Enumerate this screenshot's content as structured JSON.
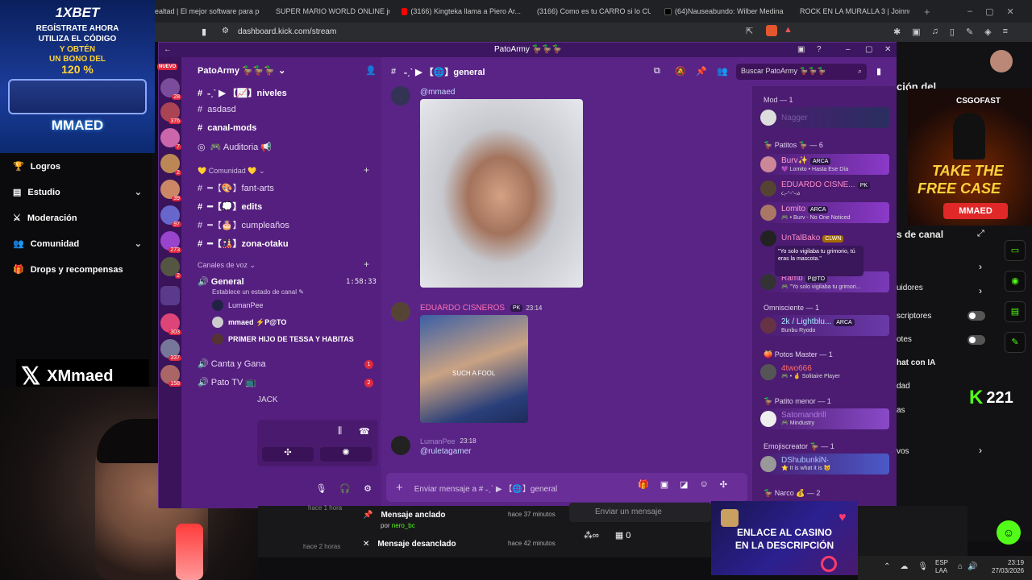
{
  "browser": {
    "tabs": [
      "ealtad | El mejor software para pote",
      "SUPER MARIO WORLD ONLINE jueg",
      "(3166) Kingteka llama a Piero Ar...",
      "(3166) Como es tu CARRO si lo CUID",
      "(64)Nauseabundo: Wilber Medina",
      "ROCK EN LA MURALLA 3 | Joinnus"
    ],
    "url": "dashboard.kick.com/stream"
  },
  "ad_1xbet": {
    "brand": "1XBET",
    "line1": "REGÍSTRATE AHORA",
    "line2": "UTILIZA EL CÓDIGO",
    "line3": "Y OBTÉN",
    "line4": "UN BONO DEL",
    "line5": "120 %",
    "code": "MMAED"
  },
  "x_handle": "XMmaed",
  "kick_nav": [
    {
      "label": "Logros",
      "icon": "trophy-icon",
      "chevron": false
    },
    {
      "label": "Estudio",
      "icon": "film-icon",
      "chevron": true
    },
    {
      "label": "Moderación",
      "icon": "sword-icon",
      "chevron": false
    },
    {
      "label": "Comunidad",
      "icon": "people-icon",
      "chevron": true
    },
    {
      "label": "Drops y recompensas",
      "icon": "gift-icon",
      "chevron": false
    }
  ],
  "discord": {
    "window_title": "PatoArmy 🦆🦆🦆",
    "server_name": "PatoArmy 🦆🦆🦆",
    "nuevo_badge": "NUEVO",
    "server_badges": [
      "28",
      "376",
      "7",
      "2",
      "39",
      "97",
      "273",
      "2",
      "303",
      "337",
      "158"
    ],
    "channels_top": [
      {
        "label": "˗ˏˋ ▶ 【📈】niveles",
        "bold": true
      },
      {
        "label": "asdasd",
        "bold": false
      },
      {
        "label": "canal-mods",
        "bold": true
      },
      {
        "label": "🎮 Auditoria 📢",
        "bold": false
      }
    ],
    "category_comunidad": "💛 Comunidad 💛",
    "channels_comunidad": [
      {
        "label": "━【🎨】fant-arts",
        "bold": false
      },
      {
        "label": "━【💭】edits",
        "bold": true
      },
      {
        "label": "━【🎂】cumpleaños",
        "bold": false
      },
      {
        "label": "━【🎎】zona-otaku",
        "bold": true
      }
    ],
    "category_voz": "Canales de voz",
    "voice_general": "General",
    "voice_timer": "1:58:33",
    "voice_status": "Establece un estado de canal",
    "voice_users": [
      "LumanPee",
      "mmaed ⚡P@TO",
      "PRIMER HIJO DE TESSA Y HABITAS"
    ],
    "voice_channels": [
      {
        "label": "Canta y Gana",
        "badge": "1"
      },
      {
        "label": "Pato TV 📺",
        "badge": "2"
      }
    ],
    "voice_cut": "JACK",
    "chat_channel": "˗ˏˋ ▶ 【🌐】general",
    "search_placeholder": "Buscar PatoArmy 🦆🦆🦆",
    "messages": [
      {
        "mention": "@mmaed"
      },
      {
        "author": "EDUARDO CISNEROS",
        "tag": "PK",
        "time": "23:14",
        "image_caption": "SUCH A FOOL"
      },
      {
        "author": "LumanPee",
        "time": "23:18",
        "text": "@ruletagamer"
      }
    ],
    "input_placeholder": "Enviar mensaje a # ˗ˏˋ ▶ 【🌐】general",
    "member_groups": [
      {
        "title": "Mod — 1",
        "members": [
          {
            "name": "Nagger",
            "status": "",
            "tag": ""
          }
        ]
      },
      {
        "title": "🦆 Patitos 🦆 — 6",
        "members": [
          {
            "name": "Burv✨",
            "status": "💜 Lomito • Hasta Ese Día",
            "tag": "ARCA"
          },
          {
            "name": "EDUARDO CISNE...",
            "status": "૮₍˶ᵔᵕᵔ˶₎ა",
            "tag": "PK"
          },
          {
            "name": "Lomito",
            "status": "🎮 • Burv - No One Noticed",
            "tag": "ARCA"
          },
          {
            "name": "UnTalBako",
            "status": "",
            "tag": "CLWN"
          },
          {
            "name": "Ramb",
            "status": "🎮 \"Yo solo vigilaba tu grimori...",
            "tag": "P@TO"
          }
        ]
      },
      {
        "title": "Omnisciente — 1",
        "members": [
          {
            "name": "2k / Lightblu...",
            "status": "Bunbu Ryodo",
            "tag": "ARCA"
          }
        ]
      },
      {
        "title": "🍑 Potos Master — 1",
        "members": [
          {
            "name": "4two666",
            "status": "🎮 • 🤞 Solitaire Player",
            "tag": ""
          }
        ]
      },
      {
        "title": "🦆 Patito menor — 1",
        "members": [
          {
            "name": "Satomandrill",
            "status": "🎮 Mindustry",
            "tag": ""
          }
        ]
      },
      {
        "title": "Emojiscreator 🦆 — 1",
        "members": [
          {
            "name": "DShubunkiN·",
            "status": "⭐ It is what it is 😺",
            "tag": ""
          }
        ]
      },
      {
        "title": "🦆 Narco 💰 — 2",
        "members": []
      }
    ],
    "tooltip": "\"Yo solo vigilaba tu grimorio, tú eras la mascota.\""
  },
  "kick_right": {
    "items": [
      "ción del",
      "s de canal",
      "uidores",
      "scriptores",
      "otes",
      "hat con IA",
      "dad",
      "as",
      "vos"
    ],
    "viewer_count": "221"
  },
  "csgo_ad": {
    "brand": "CSGOFAST",
    "line1": "TAKE THE",
    "line2": "FREE CASE",
    "code": "MMAED"
  },
  "kick_bottom": {
    "pinned": {
      "label": "Mensaje anclado",
      "by_prefix": "por",
      "by": "nero_bc",
      "time": "hace 37 minutos"
    },
    "unpinned": {
      "label": "Mensaje desanclado",
      "time": "hace 42 minutos"
    },
    "older1": "hace 1 hora",
    "older2": "hace 2 horas",
    "chat_placeholder": "Enviar un mensaje",
    "points": "0"
  },
  "casino_ad": {
    "line1": "ENLACE AL CASINO",
    "line2": "EN LA DESCRIPCIÓN"
  },
  "taskbar": {
    "lang": "ESP",
    "lang2": "LAA",
    "time": "23:19",
    "date": "27/03/2026"
  },
  "colors": {
    "kick_green": "#53fc18",
    "discord_purple": "#5a2487",
    "badge_red": "#e0283f"
  }
}
